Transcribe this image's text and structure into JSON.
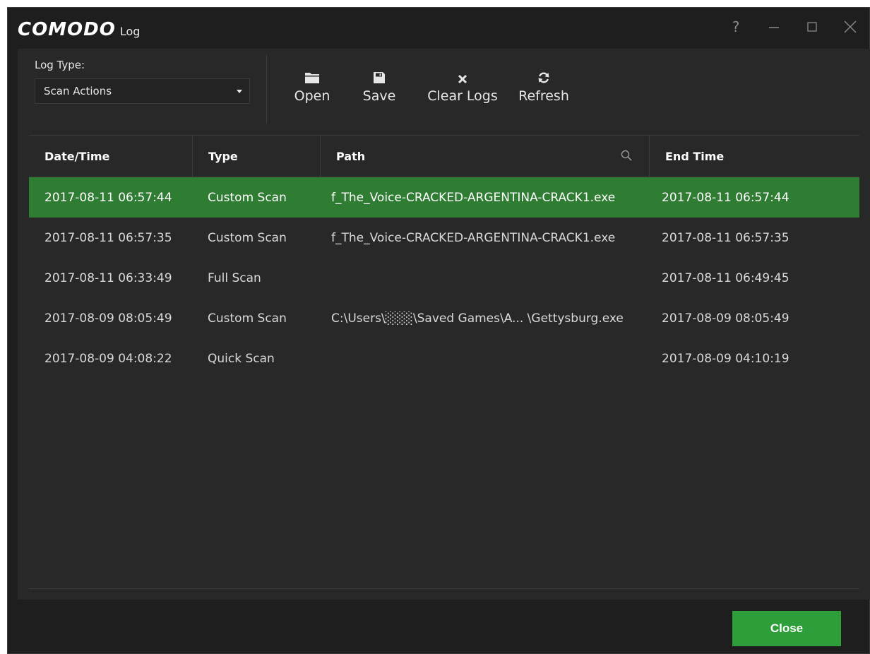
{
  "title": {
    "brand": "COMODO",
    "subtitle": "Log"
  },
  "window_controls": [
    "?",
    "minimize",
    "maximize",
    "close"
  ],
  "log_type": {
    "label": "Log Type:",
    "selected": "Scan Actions"
  },
  "toolbar": {
    "open": "Open",
    "save": "Save",
    "clear": "Clear Logs",
    "refresh": "Refresh"
  },
  "table": {
    "headers": [
      "Date/Time",
      "Type",
      "Path",
      "End Time"
    ],
    "rows": [
      {
        "date": "2017-08-11 06:57:44",
        "type": "Custom Scan",
        "path": "f_The_Voice-CRACKED-ARGENTINA-CRACK1.exe",
        "end": "2017-08-11 06:57:44",
        "selected": true
      },
      {
        "date": "2017-08-11 06:57:35",
        "type": "Custom Scan",
        "path": "f_The_Voice-CRACKED-ARGENTINA-CRACK1.exe",
        "end": "2017-08-11 06:57:35",
        "selected": false
      },
      {
        "date": "2017-08-11 06:33:49",
        "type": "Full Scan",
        "path": "",
        "end": "2017-08-11 06:49:45",
        "selected": false
      },
      {
        "date": "2017-08-09 08:05:49",
        "type": "Custom Scan",
        "path": "C:\\Users\\░░░\\Saved Games\\A...  \\Gettysburg.exe",
        "end": "2017-08-09 08:05:49",
        "selected": false
      },
      {
        "date": "2017-08-09 04:08:22",
        "type": "Quick Scan",
        "path": "",
        "end": "2017-08-09 04:10:19",
        "selected": false
      }
    ]
  },
  "footer": {
    "close": "Close"
  },
  "colors": {
    "accent": "#2e9e3a",
    "selected_row": "#2e7d32",
    "background": "#1e1e1e",
    "panel": "#282828"
  },
  "icons": [
    "help-icon",
    "minimize-icon",
    "maximize-icon",
    "close-icon",
    "folder-icon",
    "save-icon",
    "clear-icon",
    "refresh-icon",
    "search-icon",
    "dropdown-arrow-icon"
  ]
}
